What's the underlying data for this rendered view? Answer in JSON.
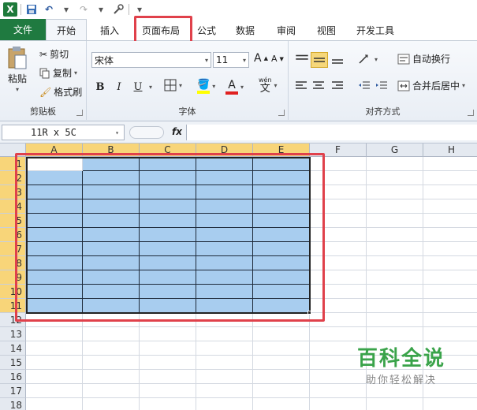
{
  "qat": {
    "logo": "X",
    "undo": "↶",
    "redo": "↷",
    "dropdown": "▾"
  },
  "tabs": [
    {
      "label": "文件"
    },
    {
      "label": "开始"
    },
    {
      "label": "插入"
    },
    {
      "label": "页面布局"
    },
    {
      "label": "公式"
    },
    {
      "label": "数据"
    },
    {
      "label": "审阅"
    },
    {
      "label": "视图"
    },
    {
      "label": "开发工具"
    }
  ],
  "clipboard": {
    "paste": "粘贴",
    "cut": "剪切",
    "copy": "复制",
    "format_painter": "格式刷",
    "label": "剪贴板"
  },
  "font": {
    "name": "宋体",
    "size": "11",
    "label": "字体",
    "bold": "B",
    "italic": "I",
    "underline": "U",
    "grow": "A",
    "shrink": "A",
    "color_letter": "A",
    "wen": "wén",
    "wen_char": "文"
  },
  "align": {
    "wrap": "自动换行",
    "merge": "合并后居中",
    "label": "对齐方式"
  },
  "formula": {
    "namebox": "11R x 5C",
    "fx": "fx",
    "value": ""
  },
  "columns": [
    "A",
    "B",
    "C",
    "D",
    "E",
    "F",
    "G",
    "H"
  ],
  "rows": [
    "1",
    "2",
    "3",
    "4",
    "5",
    "6",
    "7",
    "8",
    "9",
    "10",
    "11",
    "12",
    "13",
    "14",
    "15",
    "16",
    "17",
    "18"
  ],
  "selection": {
    "rows": 11,
    "cols": 5
  },
  "watermark": {
    "title": "百科全说",
    "subtitle": "助你轻松解决"
  },
  "colors": {
    "accent_red": "#e0414b",
    "file_tab": "#1f7a40",
    "selection_fill": "#a8cdef",
    "header_selected": "#f8d579"
  }
}
